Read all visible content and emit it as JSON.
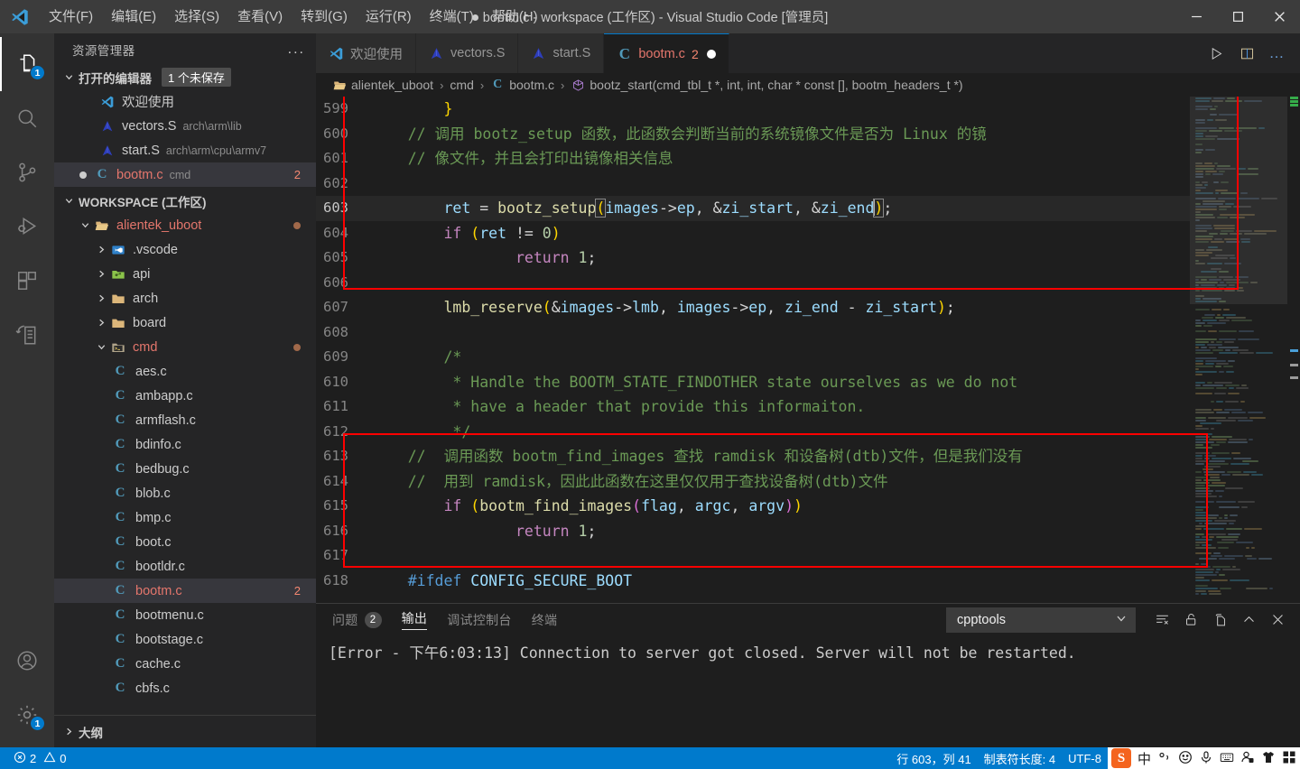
{
  "window": {
    "title": "bootm.c - workspace (工作区) - Visual Studio Code [管理员]",
    "dirty_marker": "●",
    "controls": {
      "minimize": "minimize-icon",
      "maximize": "maximize-icon",
      "close": "close-icon"
    }
  },
  "menu": [
    {
      "label": "文件(F)",
      "name": "menu-file"
    },
    {
      "label": "编辑(E)",
      "name": "menu-edit"
    },
    {
      "label": "选择(S)",
      "name": "menu-selection"
    },
    {
      "label": "查看(V)",
      "name": "menu-view"
    },
    {
      "label": "转到(G)",
      "name": "menu-goto"
    },
    {
      "label": "运行(R)",
      "name": "menu-run"
    },
    {
      "label": "终端(T)",
      "name": "menu-terminal"
    },
    {
      "label": "帮助(H)",
      "name": "menu-help"
    }
  ],
  "activitybar": {
    "items": [
      {
        "icon": "explorer-icon",
        "badge": "1",
        "active": true
      },
      {
        "icon": "search-icon",
        "badge": "",
        "active": false
      },
      {
        "icon": "source-control-icon",
        "badge": "",
        "active": false
      },
      {
        "icon": "run-and-debug-icon",
        "badge": "",
        "active": false
      },
      {
        "icon": "extensions-icon",
        "badge": "",
        "active": false
      },
      {
        "icon": "remote-explorer-icon",
        "badge": "",
        "active": false
      }
    ],
    "bottom": [
      {
        "icon": "account-icon",
        "badge": ""
      },
      {
        "icon": "gear-icon",
        "badge": "1"
      }
    ]
  },
  "sidebar": {
    "header": "资源管理器",
    "more_label": "...",
    "open_editors": {
      "label": "打开的编辑器",
      "badge": "1 个未保存",
      "items": [
        {
          "name": "欢迎使用",
          "path": "",
          "icon": "vscode-icon",
          "dirty": false,
          "errors": ""
        },
        {
          "name": "vectors.S",
          "path": "arch\\arm\\lib",
          "icon": "asm-icon",
          "dirty": false,
          "errors": ""
        },
        {
          "name": "start.S",
          "path": "arch\\arm\\cpu\\armv7",
          "icon": "asm-icon",
          "dirty": false,
          "errors": ""
        },
        {
          "name": "bootm.c",
          "path": "cmd",
          "icon": "c-icon",
          "dirty": true,
          "errors": "2"
        }
      ]
    },
    "workspace": {
      "label": "WORKSPACE (工作区)",
      "root": {
        "label": "alientek_uboot",
        "icon": "folder-open-icon",
        "modified": true,
        "expanded": true
      },
      "children": [
        {
          "label": ".vscode",
          "type": "folder",
          "icon": "vscode-folder-icon",
          "expanded": false,
          "depth": 2
        },
        {
          "label": "api",
          "type": "folder",
          "icon": "api-folder-icon",
          "expanded": false,
          "depth": 2
        },
        {
          "label": "arch",
          "type": "folder",
          "icon": "folder-icon",
          "expanded": false,
          "depth": 2
        },
        {
          "label": "board",
          "type": "folder",
          "icon": "folder-icon",
          "expanded": false,
          "depth": 2
        },
        {
          "label": "cmd",
          "type": "folder",
          "icon": "cmd-folder-icon",
          "expanded": true,
          "depth": 2,
          "modified": true
        },
        {
          "label": "aes.c",
          "type": "file",
          "icon": "c-icon",
          "depth": 3
        },
        {
          "label": "ambapp.c",
          "type": "file",
          "icon": "c-icon",
          "depth": 3
        },
        {
          "label": "armflash.c",
          "type": "file",
          "icon": "c-icon",
          "depth": 3
        },
        {
          "label": "bdinfo.c",
          "type": "file",
          "icon": "c-icon",
          "depth": 3
        },
        {
          "label": "bedbug.c",
          "type": "file",
          "icon": "c-icon",
          "depth": 3
        },
        {
          "label": "blob.c",
          "type": "file",
          "icon": "c-icon",
          "depth": 3
        },
        {
          "label": "bmp.c",
          "type": "file",
          "icon": "c-icon",
          "depth": 3
        },
        {
          "label": "boot.c",
          "type": "file",
          "icon": "c-icon",
          "depth": 3
        },
        {
          "label": "bootldr.c",
          "type": "file",
          "icon": "c-icon",
          "depth": 3
        },
        {
          "label": "bootm.c",
          "type": "file",
          "icon": "c-icon",
          "depth": 3,
          "selected": true,
          "errors": "2"
        },
        {
          "label": "bootmenu.c",
          "type": "file",
          "icon": "c-icon",
          "depth": 3
        },
        {
          "label": "bootstage.c",
          "type": "file",
          "icon": "c-icon",
          "depth": 3
        },
        {
          "label": "cache.c",
          "type": "file",
          "icon": "c-icon",
          "depth": 3
        },
        {
          "label": "cbfs.c",
          "type": "file",
          "icon": "c-icon",
          "depth": 3
        }
      ]
    },
    "outline": "大纲"
  },
  "editor": {
    "tabs": [
      {
        "label": "欢迎使用",
        "icon": "vscode-icon",
        "active": false,
        "errors": "",
        "dirty": false
      },
      {
        "label": "vectors.S",
        "icon": "asm-icon",
        "active": false,
        "errors": "",
        "dirty": false
      },
      {
        "label": "start.S",
        "icon": "asm-icon",
        "active": false,
        "errors": "",
        "dirty": false
      },
      {
        "label": "bootm.c",
        "icon": "c-icon",
        "active": true,
        "errors": "2",
        "dirty": true
      }
    ],
    "tab_actions": [
      {
        "icon": "run-icon"
      },
      {
        "icon": "split-editor-icon"
      },
      {
        "icon": "more-actions-icon"
      }
    ],
    "breadcrumb": [
      {
        "label": "alientek_uboot",
        "icon": "folder-open-icon"
      },
      {
        "label": "cmd",
        "icon": ""
      },
      {
        "label": "bootm.c",
        "icon": "c-icon"
      },
      {
        "label": "bootz_start(cmd_tbl_t *, int, int, char * const [], bootm_headers_t *)",
        "icon": "symbol-method-icon"
      }
    ],
    "breadcrumb_separator": "›",
    "lines": [
      {
        "n": "599",
        "current": false
      },
      {
        "n": "600",
        "current": false
      },
      {
        "n": "601",
        "current": false
      },
      {
        "n": "602",
        "current": false
      },
      {
        "n": "603",
        "current": true
      },
      {
        "n": "604",
        "current": false
      },
      {
        "n": "605",
        "current": false
      },
      {
        "n": "606",
        "current": false
      },
      {
        "n": "607",
        "current": false
      },
      {
        "n": "608",
        "current": false
      },
      {
        "n": "609",
        "current": false
      },
      {
        "n": "610",
        "current": false
      },
      {
        "n": "611",
        "current": false
      },
      {
        "n": "612",
        "current": false
      },
      {
        "n": "613",
        "current": false
      },
      {
        "n": "614",
        "current": false
      },
      {
        "n": "615",
        "current": false
      },
      {
        "n": "616",
        "current": false
      },
      {
        "n": "617",
        "current": false
      },
      {
        "n": "618",
        "current": false
      }
    ],
    "code_text": {
      "l599": "        }",
      "l600": "    // 调用 bootz_setup 函数，此函数会判断当前的系统镜像文件是否为 Linux 的镜",
      "l601": "    // 像文件，并且会打印出镜像相关信息",
      "l602": "",
      "l603": "        ret = bootz_setup(images->ep, &zi_start, &zi_end);",
      "l604": "        if (ret != 0)",
      "l605": "                return 1;",
      "l606": "",
      "l607": "        lmb_reserve(&images->lmb, images->ep, zi_end - zi_start);",
      "l608": "",
      "l609": "        /*",
      "l610": "         * Handle the BOOTM_STATE_FINDOTHER state ourselves as we do not",
      "l611": "         * have a header that provide this informaiton.",
      "l612": "         */",
      "l613": "    //  调用函数 bootm_find_images 查找 ramdisk 和设备树(dtb)文件，但是我们没有",
      "l614": "    //  用到 ramdisk，因此此函数在这里仅仅用于查找设备树(dtb)文件",
      "l615": "        if (bootm_find_images(flag, argc, argv))",
      "l616": "                return 1;",
      "l617": "",
      "l618": "    #ifdef CONFIG_SECURE_BOOT"
    }
  },
  "panel": {
    "tabs": [
      {
        "label": "问题",
        "badge": "2",
        "active": false
      },
      {
        "label": "输出",
        "badge": "",
        "active": true
      },
      {
        "label": "调试控制台",
        "badge": "",
        "active": false
      },
      {
        "label": "终端",
        "badge": "",
        "active": false
      }
    ],
    "channel_select": {
      "value": "cpptools",
      "icon": "chevron-down-icon"
    },
    "actions": [
      {
        "icon": "clear-output-icon"
      },
      {
        "icon": "unlock-scroll-icon"
      },
      {
        "icon": "open-in-editor-icon"
      },
      {
        "icon": "collapse-panel-icon"
      },
      {
        "icon": "close-panel-icon"
      }
    ],
    "output_text": "[Error - 下午6:03:13] Connection to server got closed. Server will not be restarted."
  },
  "statusbar": {
    "errors": "2",
    "warnings": "0",
    "error_icon": "error-circle-icon",
    "warning_icon": "warning-triangle-icon",
    "position": "行 603，列 41",
    "tab_size": "制表符长度: 4",
    "encoding": "UTF-8",
    "tray": {
      "ime_logo": "S",
      "ime_mode": "中",
      "items": [
        "punctuation-icon",
        "emoji-icon",
        "voice-input-icon",
        "soft-keyboard-icon",
        "user-icon",
        "skin-icon",
        "toolbox-icon"
      ]
    }
  },
  "colors": {
    "accent": "#007acc",
    "titlebar_bg": "#3c3c3c",
    "sidebar_bg": "#252526",
    "editor_bg": "#1e1e1e",
    "activitybar_bg": "#333333",
    "annotation_red": "#fe0000",
    "error_text": "#f48771",
    "comment_green": "#6a9955"
  }
}
